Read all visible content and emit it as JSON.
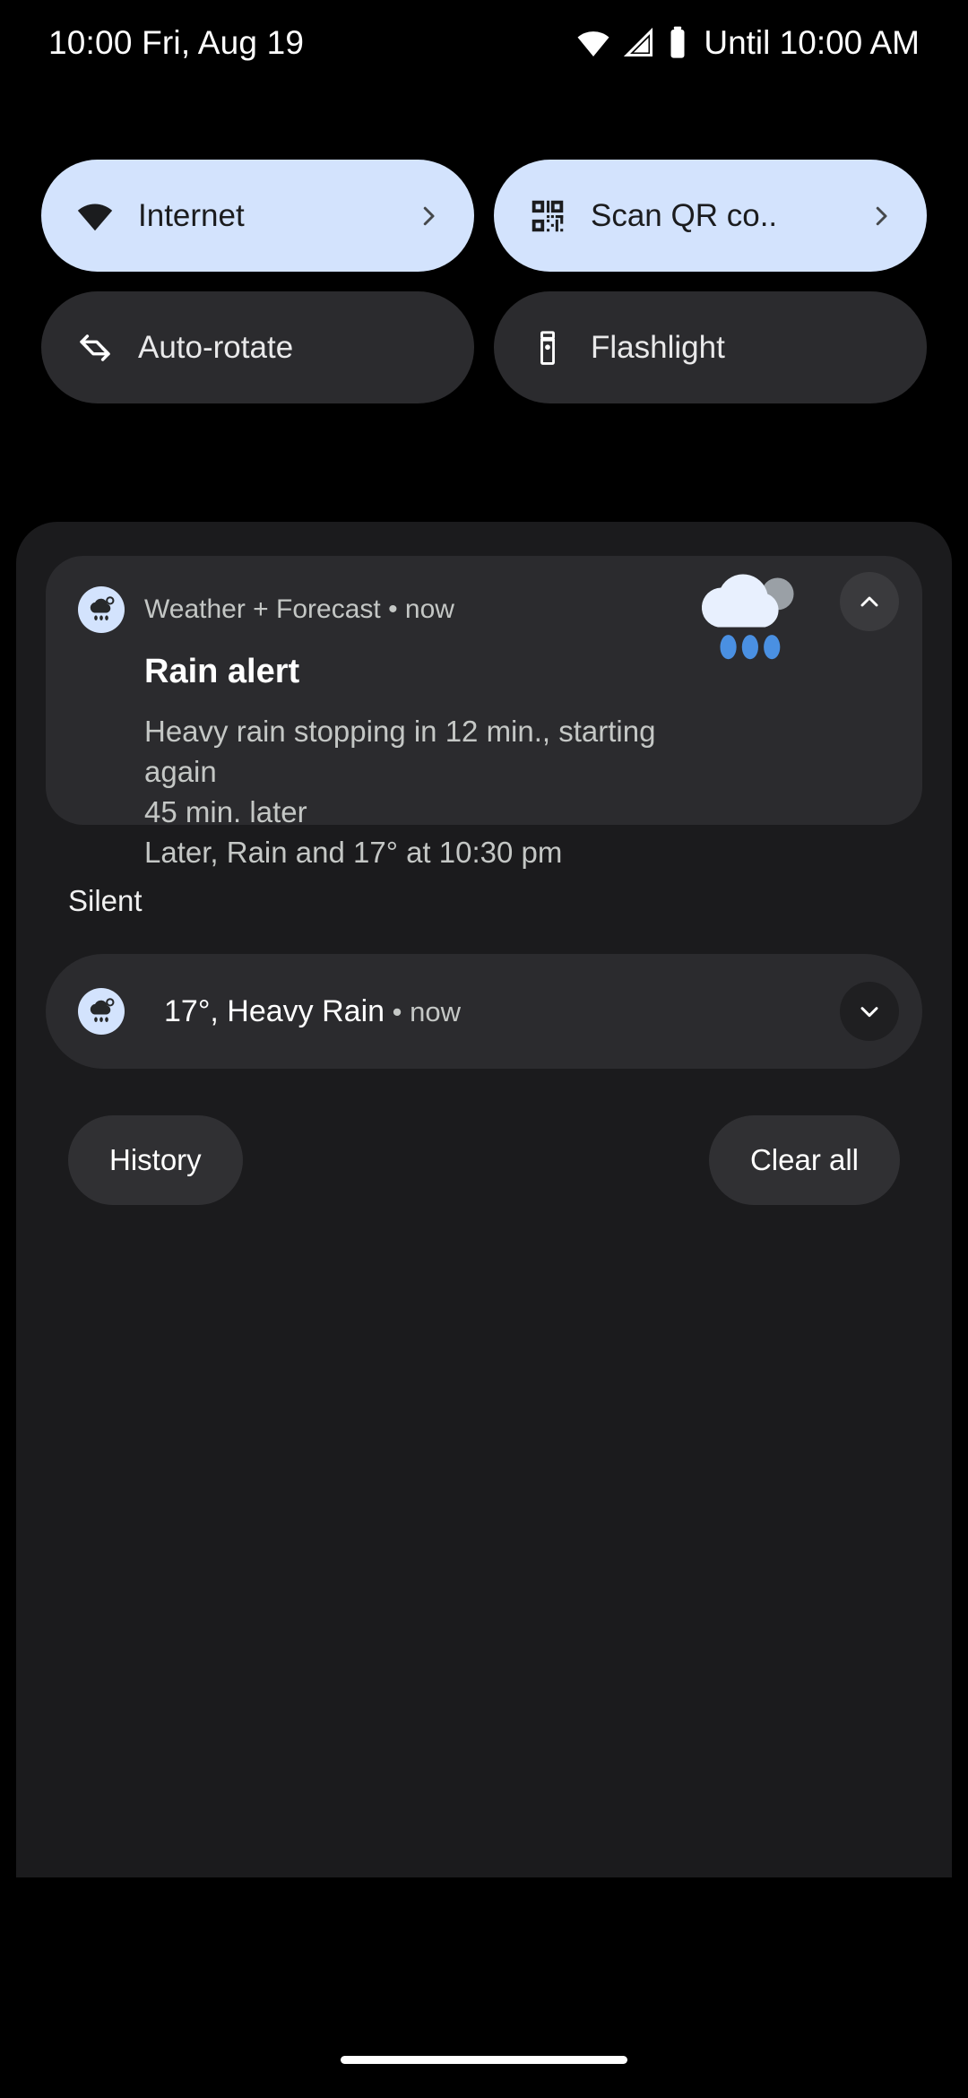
{
  "statusbar": {
    "clock": "10:00 Fri, Aug 19",
    "battery_text": "Until 10:00 AM",
    "icons": [
      "wifi-icon",
      "cellular-signal-icon",
      "battery-icon"
    ]
  },
  "quick_settings": {
    "tiles": [
      {
        "label": "Internet",
        "icon": "wifi-icon",
        "state": "active",
        "has_chevron": true
      },
      {
        "label": "Scan QR co..",
        "icon": "qr-code-icon",
        "state": "active",
        "has_chevron": true
      },
      {
        "label": "Auto-rotate",
        "icon": "auto-rotate-icon",
        "state": "inactive",
        "has_chevron": false
      },
      {
        "label": "Flashlight",
        "icon": "flashlight-icon",
        "state": "inactive",
        "has_chevron": false
      }
    ]
  },
  "notifications": {
    "alert": {
      "app_name": "Weather + Forecast",
      "separator": "•",
      "time": "now",
      "header_line": "Weather + Forecast • now",
      "title": "Rain alert",
      "body_line_1": "Heavy rain stopping in 12 min., starting again",
      "body_line_2": "45 min. later",
      "body_line_3": "Later, Rain and 17° at 10:30 pm",
      "avatar_icon": "rain-cloud-icon",
      "hero_icon": "rain-cloud-sun-icon",
      "collapse_icon": "chevron-up-icon"
    },
    "silent_header": "Silent",
    "silent_item": {
      "title": "17°, Heavy Rain",
      "separator": "•",
      "time": "now",
      "avatar_icon": "rain-cloud-icon",
      "expand_icon": "chevron-down-icon"
    }
  },
  "footer": {
    "history_label": "History",
    "clear_all_label": "Clear all"
  },
  "colors": {
    "background": "#000000",
    "shade": "#1b1b1d",
    "tile_active": "#d3e3fd",
    "tile_inactive": "#2b2b2e",
    "notification_card": "#2b2b2e",
    "accent_rain_blue": "#4a90e2",
    "text_primary": "#ffffff",
    "text_secondary": "#c4c7c5"
  }
}
